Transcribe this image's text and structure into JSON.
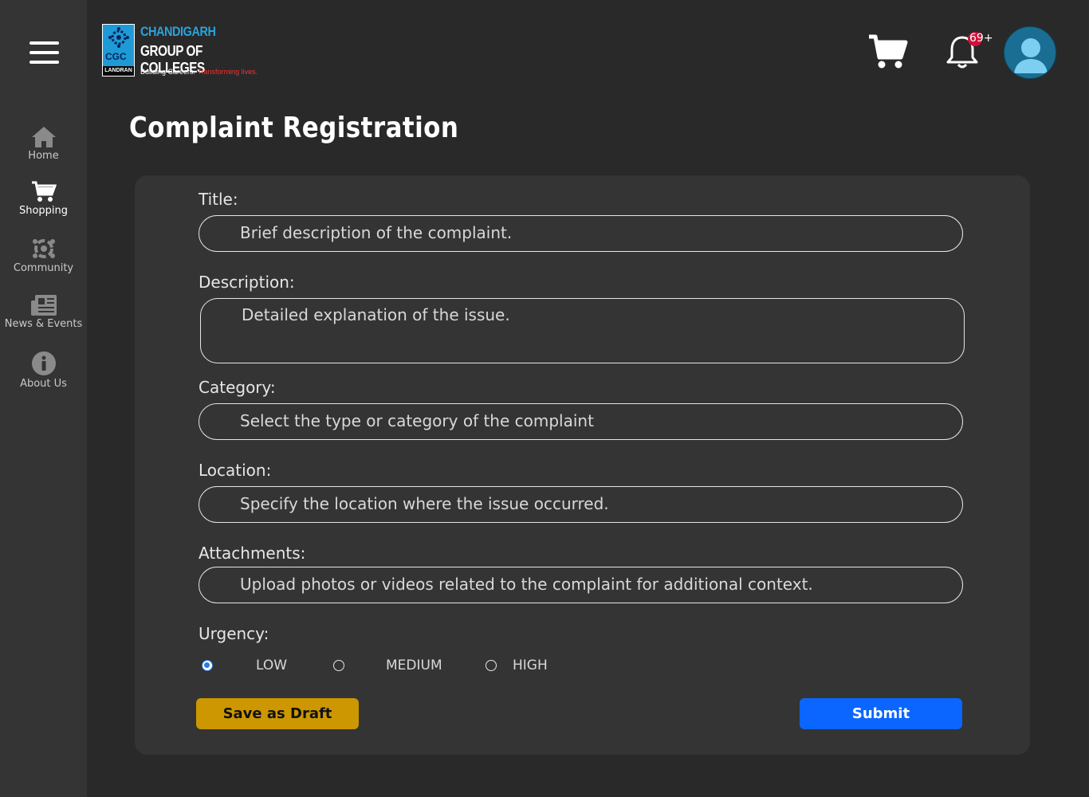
{
  "sidebar": {
    "menu_icon": "hamburger-menu-icon",
    "items": [
      {
        "label": "Home",
        "icon": "home-icon"
      },
      {
        "label": "Shopping",
        "icon": "cart-icon"
      },
      {
        "label": "Community",
        "icon": "community-icon"
      },
      {
        "label": "News & Events",
        "icon": "newspaper-icon"
      },
      {
        "label": "About Us",
        "icon": "info-icon"
      }
    ]
  },
  "header": {
    "logo": {
      "mark": "CGC",
      "sub": "LANDRAN",
      "line1": "CHANDIGARH",
      "line2": "GROUP OF COLLEGES",
      "tagline_white": "Building Careers.",
      "tagline_red": "Transforming lives."
    },
    "cart_icon": "cart-icon",
    "bell_icon": "bell-icon",
    "notification_count": "69+",
    "avatar_icon": "user-avatar-icon"
  },
  "page": {
    "title": "Complaint Registration"
  },
  "form": {
    "title_label": "Title:",
    "title_placeholder": "Brief description of the complaint.",
    "description_label": "Description:",
    "description_placeholder": "Detailed explanation of the issue.",
    "category_label": "Category:",
    "category_placeholder": "Select the type or category of the complaint",
    "location_label": "Location:",
    "location_placeholder": "Specify the location where the issue occurred.",
    "attachments_label": "Attachments:",
    "attachments_placeholder": "Upload photos or videos related to the complaint for additional context.",
    "urgency_label": "Urgency:",
    "urgency_options": [
      {
        "label": "LOW",
        "selected": true
      },
      {
        "label": "MEDIUM",
        "selected": false
      },
      {
        "label": "HIGH",
        "selected": false
      }
    ],
    "save_draft_label": "Save as Draft",
    "submit_label": "Submit"
  },
  "colors": {
    "background": "#292929",
    "sidebar": "#343434",
    "card": "#343434",
    "draft_button": "#cc9700",
    "submit_button": "#0a66ff",
    "badge": "#d0103a",
    "radio_selected": "#2a7be4"
  }
}
